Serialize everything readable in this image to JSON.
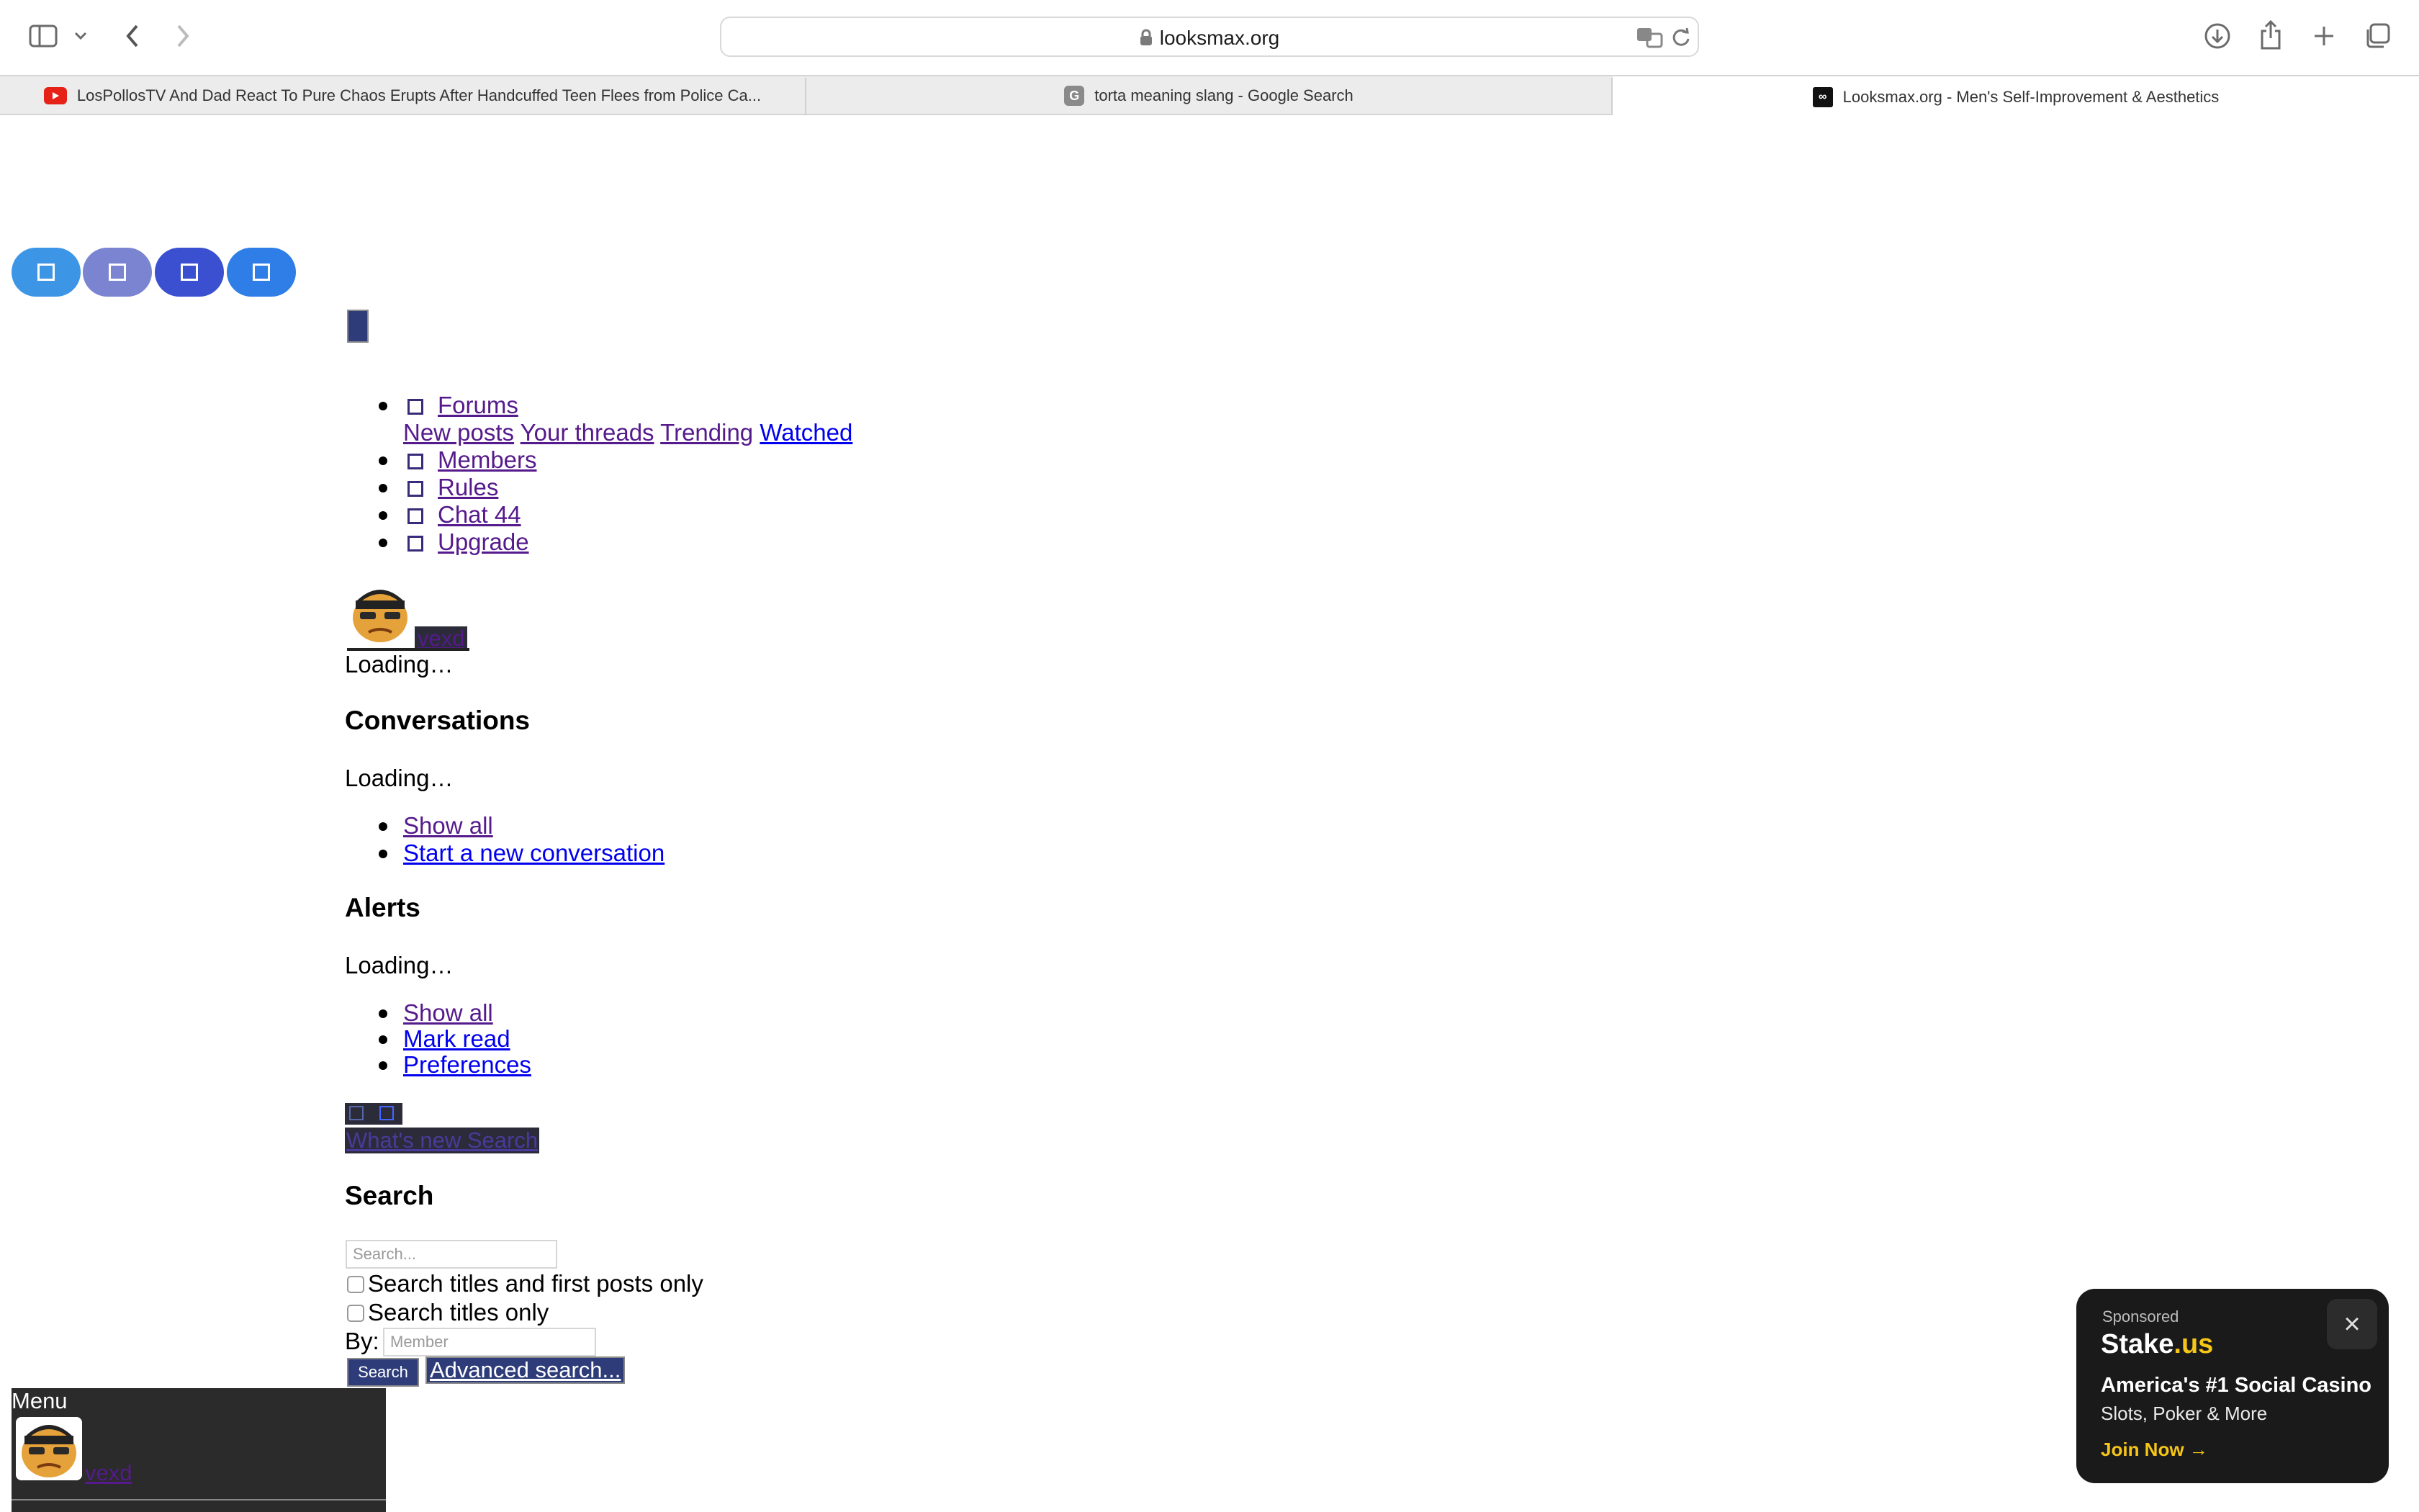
{
  "browser": {
    "url": "looksmax.org",
    "tabs": [
      {
        "title": "LosPollosTV And Dad React To Pure Chaos Erupts After Handcuffed Teen Flees from Police Ca...",
        "favicon": "youtube-icon",
        "active": false
      },
      {
        "title": "torta meaning slang - Google Search",
        "favicon": "google-icon",
        "active": false
      },
      {
        "title": "Looksmax.org - Men's Self-Improvement & Aesthetics",
        "favicon": "looksmax-icon",
        "active": true
      }
    ]
  },
  "nav": {
    "items": [
      {
        "label": "Forums"
      },
      {
        "label": "Members"
      },
      {
        "label": "Rules"
      },
      {
        "label": "Chat 44"
      },
      {
        "label": "Upgrade"
      }
    ],
    "forum_sublinks": [
      "New posts",
      "Your threads",
      "Trending",
      "Watched"
    ]
  },
  "user": {
    "name": "vexd",
    "loading": "Loading…"
  },
  "conversations": {
    "heading": "Conversations",
    "loading": "Loading…",
    "links": [
      "Show all",
      "Start a new conversation"
    ]
  },
  "alerts": {
    "heading": "Alerts",
    "loading": "Loading…",
    "links": [
      "Show all",
      "Mark read",
      "Preferences"
    ]
  },
  "whatsnew": {
    "label": "What's new Search"
  },
  "search": {
    "heading": "Search",
    "placeholder": "Search...",
    "option1": "Search titles and first posts only",
    "option2": "Search titles only",
    "by_label": "By:",
    "member_placeholder": "Member",
    "button": "Search",
    "advanced": "Advanced search..."
  },
  "menu": {
    "label": "Menu",
    "user": "vexd"
  },
  "ad": {
    "sponsored": "Sponsored",
    "brand_main": "Stake",
    "brand_suffix": ".us",
    "headline": "America's #1 Social Casino",
    "subline": "Slots, Poker & More",
    "cta": "Join Now →",
    "close": "×"
  },
  "colors": {
    "circle1": "#3d95e6",
    "circle2": "#7a84d0",
    "circle3": "#3a50d0",
    "circle4": "#2f7de6",
    "accent_gold": "#f5c518"
  }
}
